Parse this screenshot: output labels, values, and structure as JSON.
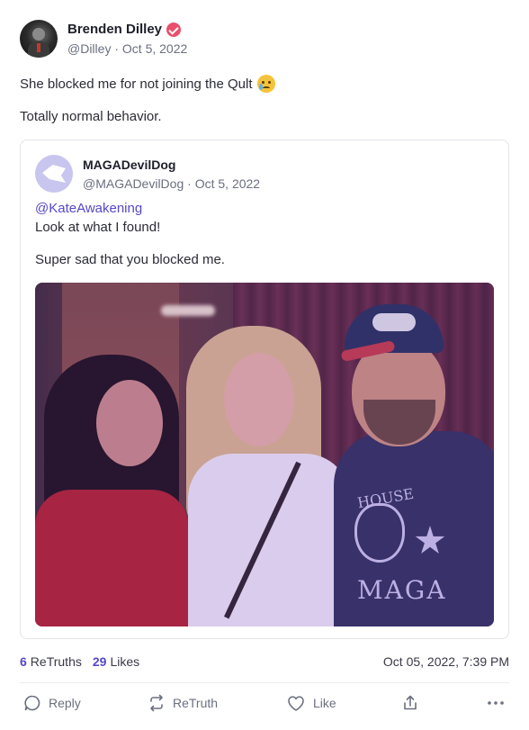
{
  "post": {
    "author": {
      "display_name": "Brenden Dilley",
      "handle": "@Dilley",
      "date": "Oct 5, 2022",
      "verified": true
    },
    "text_line1": "She blocked me for not joining the Qult",
    "text_line1_emoji": "crying-face-emoji",
    "text_line2": "Totally normal behavior.",
    "quoted": {
      "author": {
        "display_name": "MAGADevilDog",
        "handle": "@MAGADevilDog",
        "date": "Oct 5, 2022"
      },
      "mention": "@KateAwakening",
      "line1": "Look at what I found!",
      "line2": "Super sad that you blocked me.",
      "photo_shirt_text_top": "HOUSE",
      "photo_shirt_text_bottom": "MAGA"
    },
    "stats": {
      "retruths_count": "6",
      "retruths_label": "ReTruths",
      "likes_count": "29",
      "likes_label": "Likes",
      "timestamp": "Oct 05, 2022, 7:39 PM"
    },
    "actions": {
      "reply": "Reply",
      "retruth": "ReTruth",
      "like": "Like"
    }
  },
  "colors": {
    "accent": "#5448c8",
    "verified": "#e94f6b",
    "muted_text": "#6b6f80"
  }
}
